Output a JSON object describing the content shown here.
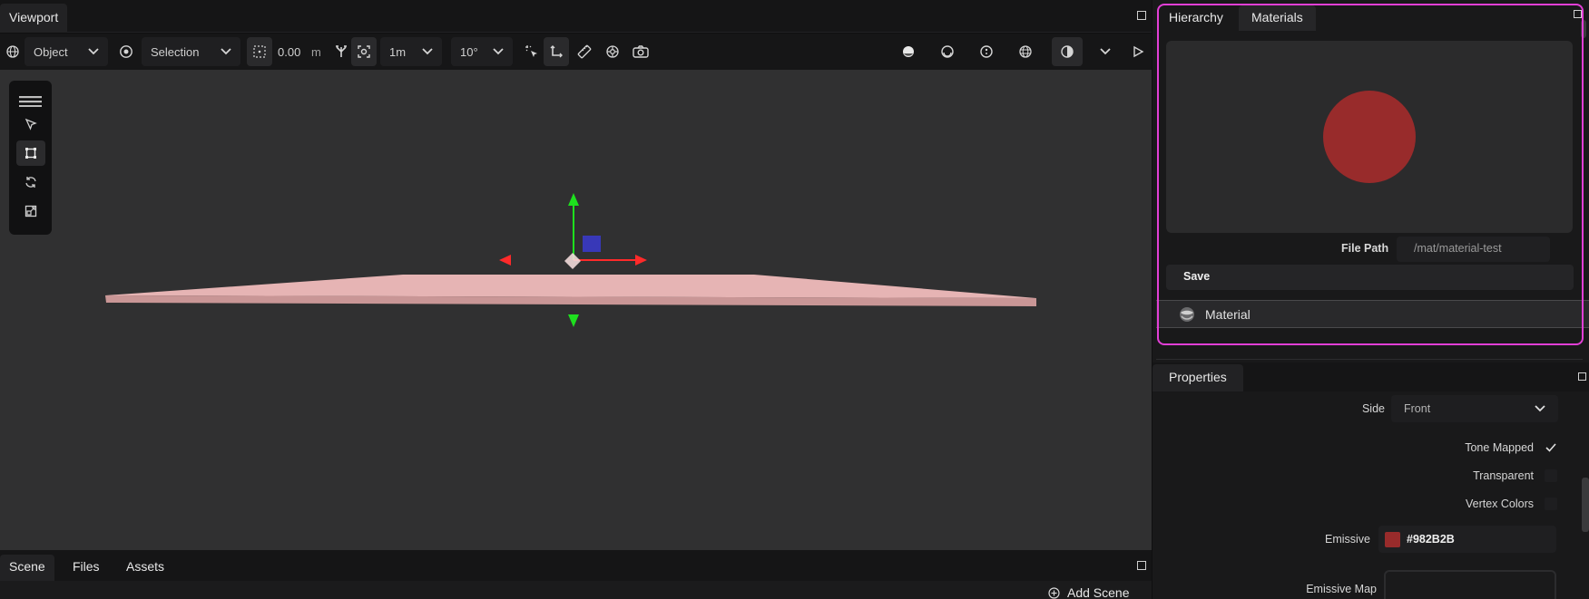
{
  "viewport": {
    "tab_label": "Viewport",
    "toolbar": {
      "transform_space": "Object",
      "pivot_mode": "Selection",
      "grid_value": "0.00",
      "grid_unit": "m",
      "translation_snap": "1m",
      "rotation_snap": "10°"
    }
  },
  "bottom": {
    "tabs": [
      "Scene",
      "Files",
      "Assets"
    ],
    "add_scene_label": "Add Scene"
  },
  "materials_panel": {
    "tabs": [
      "Hierarchy",
      "Materials"
    ],
    "preview_color": "#982B2B",
    "file_path_label": "File Path",
    "file_path_value": "/mat/material-test",
    "save_label": "Save",
    "material_item_label": "Material",
    "highlight_color": "#e23fd6"
  },
  "properties_panel": {
    "tab_label": "Properties",
    "side_label": "Side",
    "side_value": "Front",
    "tone_mapped_label": "Tone Mapped",
    "tone_mapped_checked": true,
    "transparent_label": "Transparent",
    "transparent_checked": false,
    "vertex_colors_label": "Vertex Colors",
    "vertex_colors_checked": false,
    "emissive_label": "Emissive",
    "emissive_value": "#982B2B",
    "emissive_map_label": "Emissive Map"
  },
  "icons": {
    "gizmo_x_color": "#ff2a2a",
    "gizmo_y_color": "#1ee01e",
    "gizmo_z_color": "#3a3ad0",
    "plane_color": "#e6b4b4"
  }
}
